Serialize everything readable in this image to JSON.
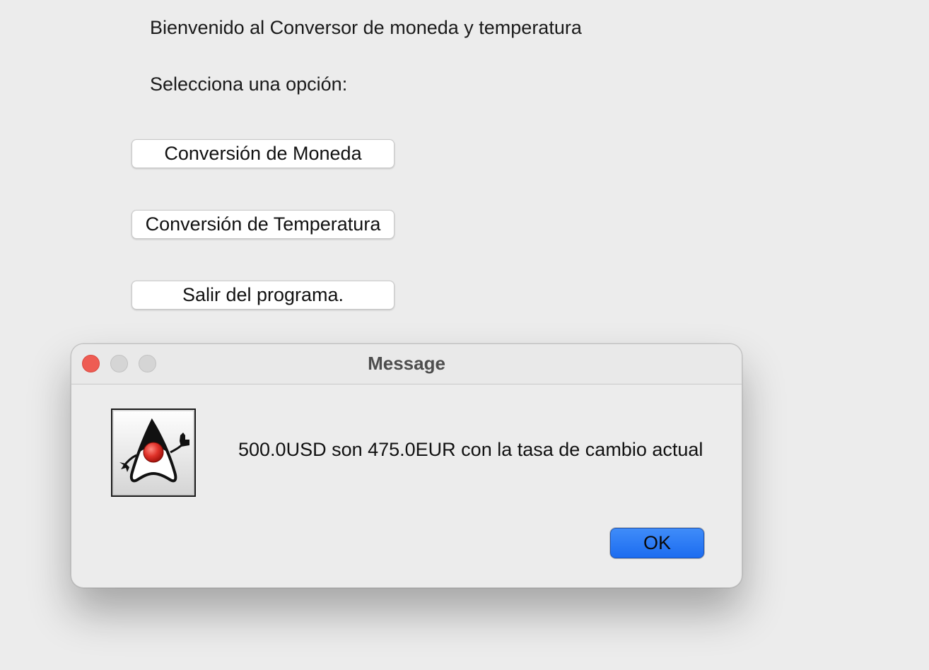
{
  "main": {
    "welcome": "Bienvenido al Conversor de moneda y temperatura",
    "prompt": "Selecciona una opción:",
    "buttons": {
      "currency": "Conversión de Moneda",
      "temperature": "Conversión de Temperatura",
      "exit": "Salir del programa."
    }
  },
  "dialog": {
    "title": "Message",
    "message": "500.0USD son 475.0EUR con la tasa de cambio actual",
    "ok_label": "OK",
    "icon": "java-duke-icon"
  },
  "colors": {
    "background": "#ececec",
    "close": "#ee5c53",
    "ok_button": "#2a77f4"
  }
}
